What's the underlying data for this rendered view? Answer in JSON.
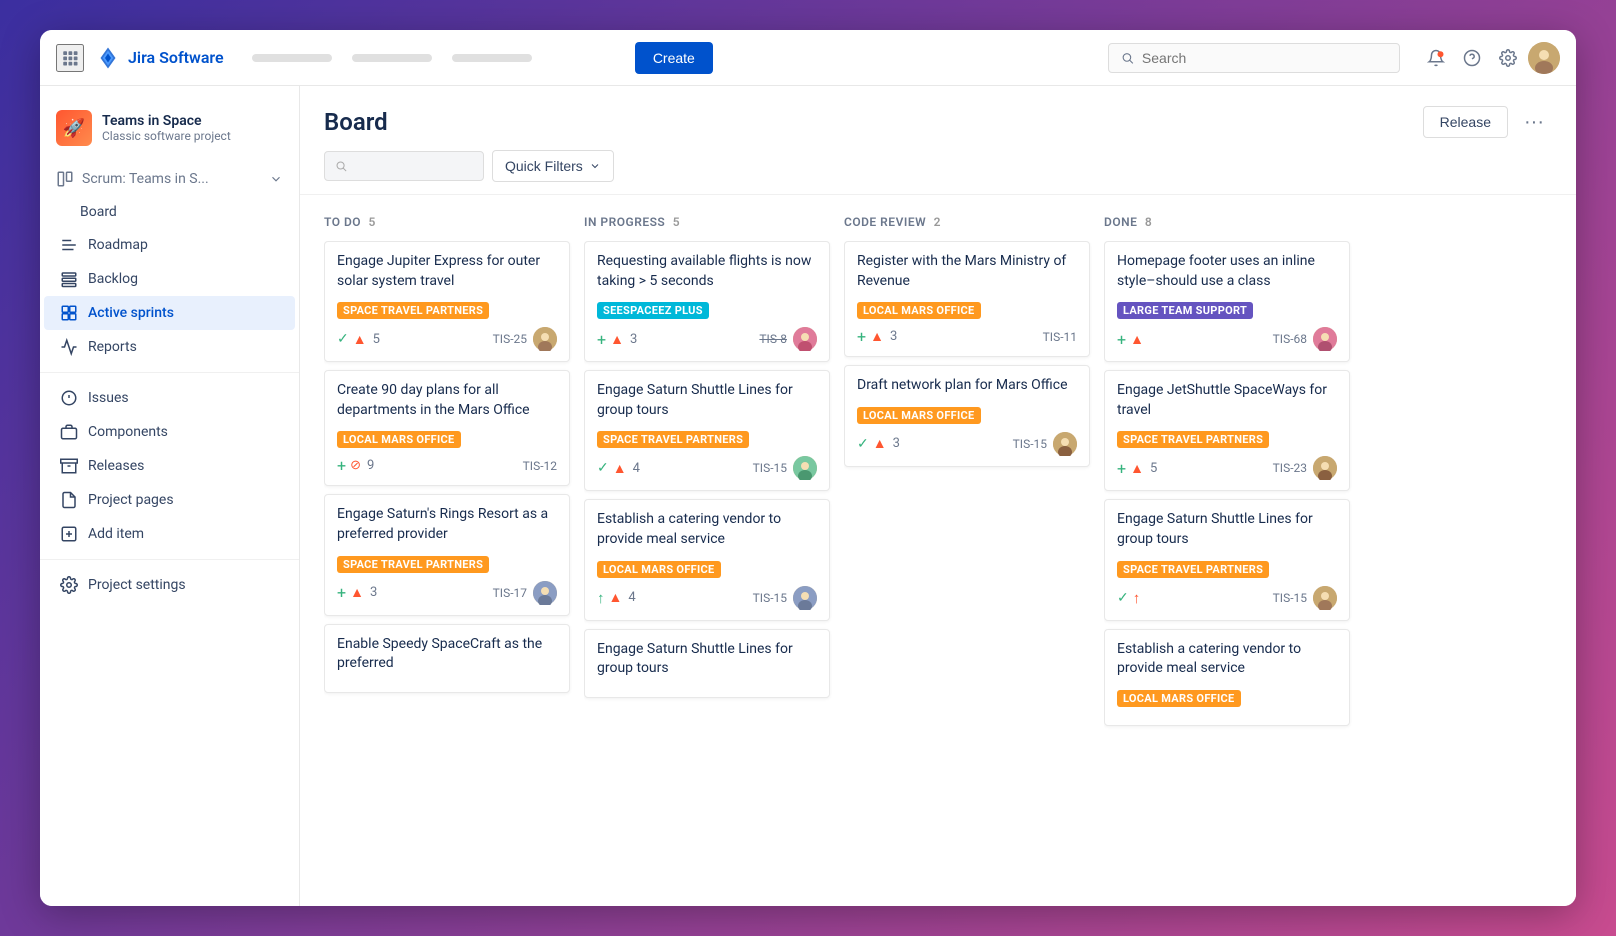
{
  "app": {
    "name": "Jira Software",
    "create_label": "Create",
    "search_placeholder": "Search",
    "nav_links": [
      "",
      "",
      ""
    ]
  },
  "sidebar": {
    "project_name": "Teams in Space",
    "project_type": "Classic software project",
    "board_label": "Board",
    "scrum_label": "Scrum: Teams in S...",
    "items": [
      {
        "id": "roadmap",
        "label": "Roadmap"
      },
      {
        "id": "backlog",
        "label": "Backlog"
      },
      {
        "id": "active-sprints",
        "label": "Active sprints"
      },
      {
        "id": "reports",
        "label": "Reports"
      },
      {
        "id": "issues",
        "label": "Issues"
      },
      {
        "id": "components",
        "label": "Components"
      },
      {
        "id": "releases",
        "label": "Releases"
      },
      {
        "id": "project-pages",
        "label": "Project pages"
      },
      {
        "id": "add-item",
        "label": "Add item"
      },
      {
        "id": "project-settings",
        "label": "Project settings"
      }
    ]
  },
  "board": {
    "title": "Board",
    "release_label": "Release",
    "more_label": "...",
    "filter_label": "Quick Filters",
    "columns": [
      {
        "id": "todo",
        "title": "TO DO",
        "count": 5,
        "cards": [
          {
            "title": "Engage Jupiter Express for outer solar system travel",
            "label": "SPACE TRAVEL PARTNERS",
            "label_color": "orange",
            "icons": [
              "check",
              "up"
            ],
            "count": "5",
            "id": "TIS-25",
            "avatar": "person1"
          },
          {
            "title": "Create 90 day plans for all departments in the Mars Office",
            "label": "LOCAL MARS OFFICE",
            "label_color": "orange",
            "icons": [
              "green-up",
              "block"
            ],
            "count": "9",
            "id": "TIS-12",
            "avatar": null
          },
          {
            "title": "Engage Saturn's Rings Resort as a preferred provider",
            "label": "SPACE TRAVEL PARTNERS",
            "label_color": "orange",
            "icons": [
              "green-up",
              "up"
            ],
            "count": "3",
            "id": "TIS-17",
            "avatar": "person2"
          },
          {
            "title": "Enable Speedy SpaceCraft as the preferred",
            "label": "",
            "label_color": "",
            "icons": [],
            "count": "",
            "id": "",
            "avatar": null
          }
        ]
      },
      {
        "id": "in-progress",
        "title": "IN PROGRESS",
        "count": 5,
        "cards": [
          {
            "title": "Requesting available flights is now taking > 5 seconds",
            "label": "SEESPACEEZ PLUS",
            "label_color": "teal",
            "icons": [
              "green-up",
              "up"
            ],
            "count": "3",
            "id": "TIS-8",
            "avatar": "person3",
            "id_strike": true
          },
          {
            "title": "Engage Saturn Shuttle Lines for group tours",
            "label": "SPACE TRAVEL PARTNERS",
            "label_color": "orange",
            "icons": [
              "check",
              "up"
            ],
            "count": "4",
            "id": "TIS-15",
            "avatar": "person4"
          },
          {
            "title": "Establish a catering vendor to provide meal service",
            "label": "LOCAL MARS OFFICE",
            "label_color": "orange",
            "icons": [
              "green-up2",
              "up"
            ],
            "count": "4",
            "id": "TIS-15",
            "avatar": "person5"
          },
          {
            "title": "Engage Saturn Shuttle Lines for group tours",
            "label": "",
            "label_color": "",
            "icons": [],
            "count": "",
            "id": "",
            "avatar": null
          }
        ]
      },
      {
        "id": "code-review",
        "title": "CODE REVIEW",
        "count": 2,
        "cards": [
          {
            "title": "Register with the Mars Ministry of Revenue LOCAL MARS OFFICE",
            "label": "LOCAL MARS OFFICE",
            "label_color": "orange",
            "icons": [
              "green-up",
              "up"
            ],
            "count": "3",
            "id": "TIS-11",
            "avatar": null
          },
          {
            "title": "Draft network plan for Mars Office",
            "label": "LOCAL MARS OFFICE",
            "label_color": "orange",
            "icons": [
              "check",
              "up"
            ],
            "count": "3",
            "id": "TIS-15",
            "avatar": "person6"
          }
        ]
      },
      {
        "id": "done",
        "title": "DONE",
        "count": 8,
        "cards": [
          {
            "title": "Homepage footer uses an inline style–should use a class",
            "label": "LARGE TEAM SUPPORT",
            "label_color": "purple",
            "icons": [
              "green-up",
              "up"
            ],
            "count": "",
            "id": "TIS-68",
            "avatar": "person7"
          },
          {
            "title": "Engage JetShuttle SpaceWays for travel",
            "label": "SPACE TRAVEL PARTNERS",
            "label_color": "orange",
            "icons": [
              "green-up",
              "up"
            ],
            "count": "5",
            "id": "TIS-23",
            "avatar": "person8"
          },
          {
            "title": "Engage Saturn Shuttle Lines for group tours",
            "label": "SPACE TRAVEL PARTNERS",
            "label_color": "orange",
            "icons": [
              "check",
              "up-pink"
            ],
            "count": "",
            "id": "TIS-15",
            "avatar": "person9"
          },
          {
            "title": "Establish a catering vendor to provide meal service",
            "label": "LOCAL MARS OFFICE",
            "label_color": "orange",
            "icons": [],
            "count": "",
            "id": "",
            "avatar": null
          }
        ]
      }
    ]
  }
}
